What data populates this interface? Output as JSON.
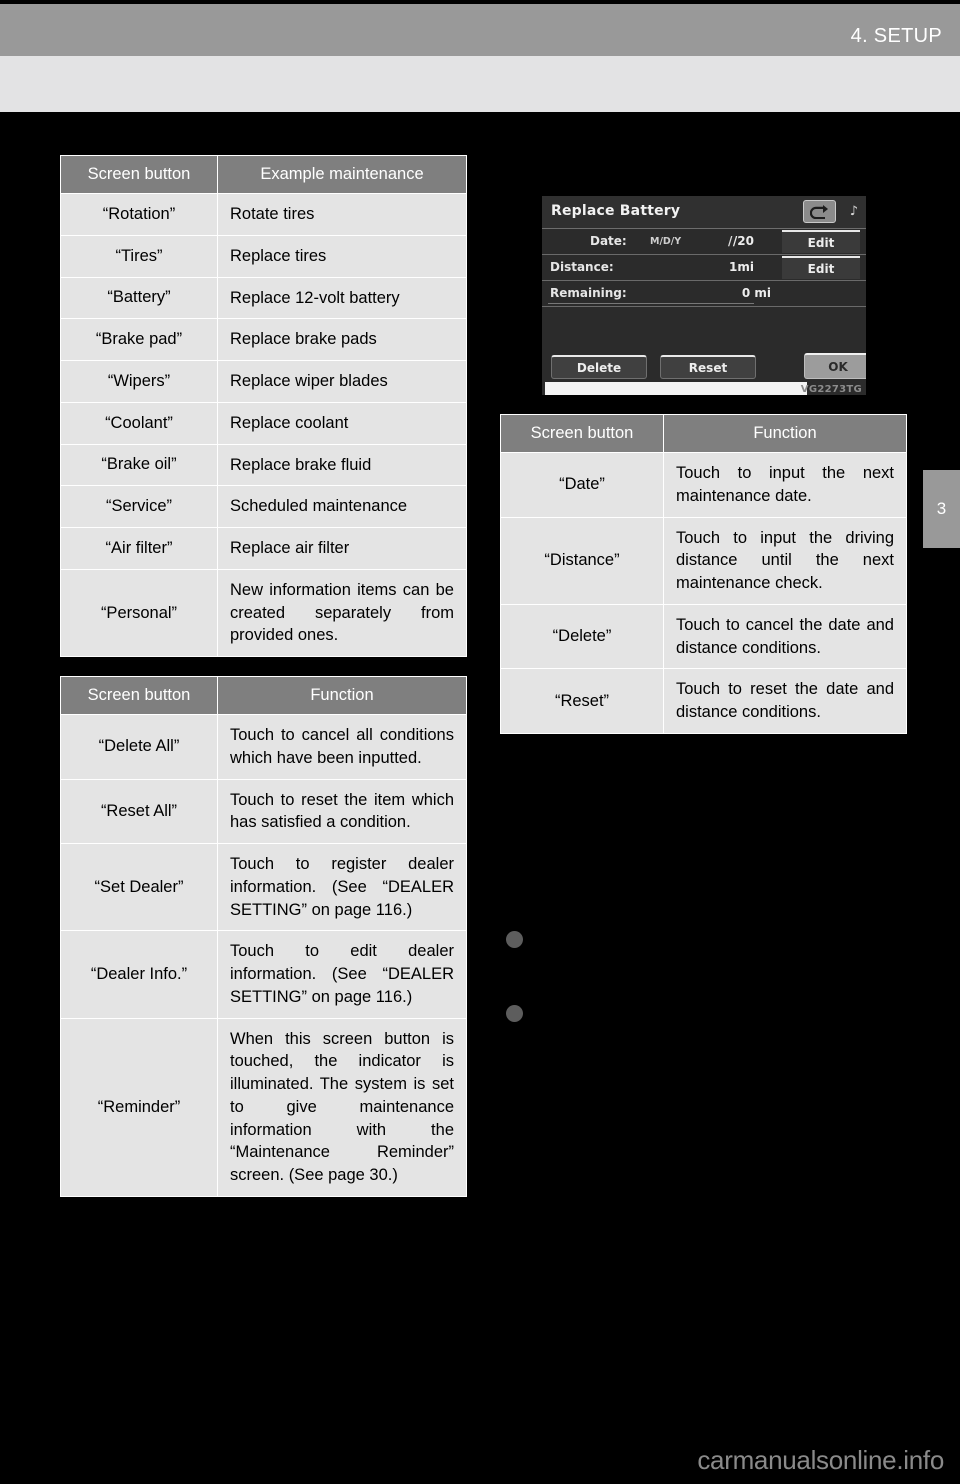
{
  "header": {
    "title": "4. SETUP",
    "chapter_tab": "3"
  },
  "tables": {
    "example_maintenance": {
      "headers": [
        "Screen button",
        "Example maintenance"
      ],
      "rows": [
        {
          "button": "“Rotation”",
          "value": "Rotate tires"
        },
        {
          "button": "“Tires”",
          "value": "Replace tires"
        },
        {
          "button": "“Battery”",
          "value": "Replace 12-volt battery"
        },
        {
          "button": "“Brake pad”",
          "value": "Replace brake pads"
        },
        {
          "button": "“Wipers”",
          "value": "Replace wiper blades"
        },
        {
          "button": "“Coolant”",
          "value": "Replace coolant"
        },
        {
          "button": "“Brake oil”",
          "value": "Replace brake fluid"
        },
        {
          "button": "“Service”",
          "value": "Scheduled maintenance"
        },
        {
          "button": "“Air filter”",
          "value": "Replace air filter"
        },
        {
          "button": "“Personal”",
          "value": "New information items can be created separately from provided ones."
        }
      ]
    },
    "maintenance_functions": {
      "headers": [
        "Screen button",
        "Function"
      ],
      "rows": [
        {
          "button": "“Delete All”",
          "value": "Touch to cancel all conditions which have been inputted."
        },
        {
          "button": "“Reset All”",
          "value": "Touch to reset the item which has satisfied a condition."
        },
        {
          "button": "“Set Dealer”",
          "value": "Touch to register dealer information. (See “DEALER SETTING” on page 116.)"
        },
        {
          "button": "“Dealer Info.”",
          "value": "Touch to edit dealer information. (See “DEALER SETTING” on page 116.)"
        },
        {
          "button": "“Reminder”",
          "value": "When this screen button is touched, the indicator is illuminated. The system is set to give maintenance information with the “Maintenance Reminder” screen. (See page 30.)"
        }
      ]
    },
    "item_functions": {
      "headers": [
        "Screen button",
        "Function"
      ],
      "rows": [
        {
          "button": "“Date”",
          "value": "Touch to input the next maintenance date."
        },
        {
          "button": "“Distance”",
          "value": "Touch to input the driving distance until the next maintenance check."
        },
        {
          "button": "“Delete”",
          "value": "Touch to cancel the date and distance conditions."
        },
        {
          "button": "“Reset”",
          "value": "Touch to reset the date and distance conditions."
        }
      ]
    }
  },
  "figure": {
    "title": "Replace Battery",
    "back_icon": "return-arrow-icon",
    "music_icon": "♪",
    "rows": [
      {
        "label": "Date:",
        "format": "M/D/Y",
        "slash": "/",
        "value": "/20",
        "action": "Edit"
      },
      {
        "label": "Distance:",
        "format": "",
        "slash": "",
        "value": "1mi",
        "action": "Edit"
      },
      {
        "label": "Remaining:",
        "format": "",
        "slash": "",
        "value": "0 mi",
        "action": ""
      }
    ],
    "buttons": {
      "delete": "Delete",
      "reset": "Reset",
      "ok": "OK"
    },
    "image_code": "VG2273TG"
  },
  "footer": {
    "watermark": "carmanualsonline.info"
  },
  "colors": {
    "header_gray": "#999999",
    "header_sub": "#e3e3e4",
    "table_header": "#7f7f7f",
    "table_cell": "#e4e4e4",
    "page_bg": "#000000",
    "bullet": "#5d5d5d",
    "watermark": "#8a8a8a"
  }
}
